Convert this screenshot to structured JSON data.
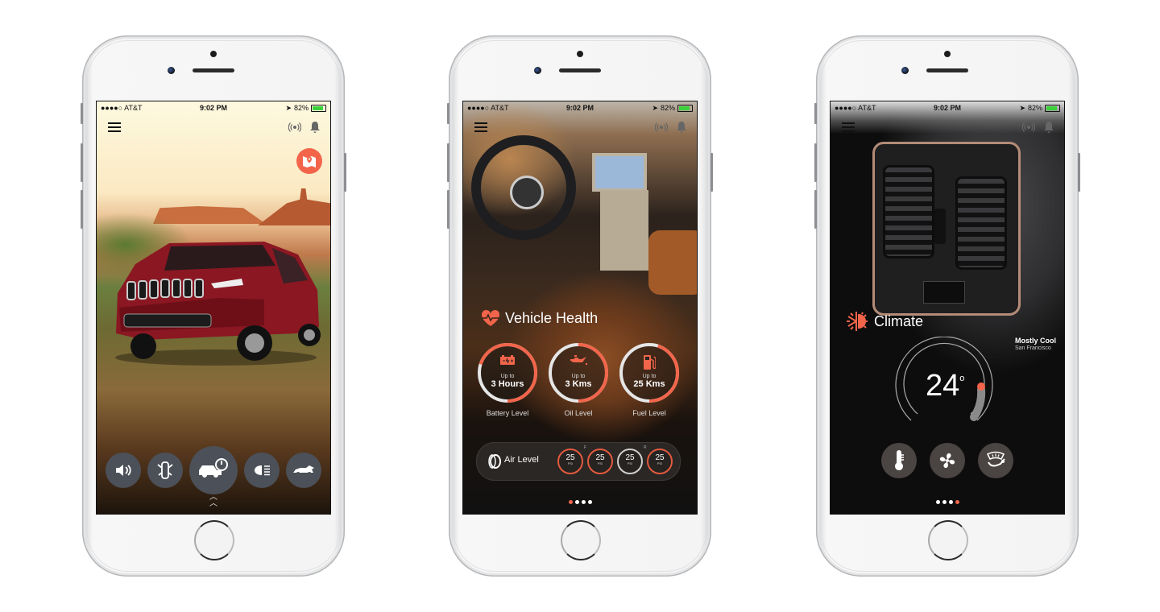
{
  "status_bar": {
    "carrier": "●●●●○ AT&T",
    "time": "9:02 PM",
    "battery": "82%",
    "icons": [
      "wifi-icon",
      "orientation-lock-icon",
      "location-icon",
      "bluetooth-icon",
      "battery-icon",
      "charging-icon"
    ]
  },
  "header": {
    "menu_icon": "hamburger-menu-icon",
    "icons": [
      "signal-broadcast-icon",
      "notification-bell-icon"
    ]
  },
  "phones": [
    {
      "screen": "home",
      "map_button": "map-pin-icon",
      "controls": [
        {
          "name": "horn",
          "icon": "speaker-icon",
          "active": false
        },
        {
          "name": "doors",
          "icon": "car-doors-icon",
          "active": true
        },
        {
          "name": "remote-start",
          "icon": "car-power-icon",
          "active": true
        },
        {
          "name": "lights",
          "icon": "headlight-icon",
          "active": false
        },
        {
          "name": "trunk",
          "icon": "car-trunk-icon",
          "active": false
        }
      ],
      "expand_icon": "double-chevron-up-icon"
    },
    {
      "screen": "vehicle-health",
      "title": "Vehicle Health",
      "gauges": [
        {
          "prefix": "Up to",
          "value": "3 Hours",
          "label": "Battery Level",
          "icon": "battery-icon",
          "level": 0.7
        },
        {
          "prefix": "Up to",
          "value": "3 Kms",
          "label": "Oil Level",
          "icon": "oil-can-icon",
          "level": 0.5
        },
        {
          "prefix": "Up to",
          "value": "25 Kms",
          "label": "Fuel Level",
          "icon": "fuel-pump-icon",
          "level": 0.45
        }
      ],
      "air": {
        "label": "Air Level",
        "tyres": [
          {
            "value": "25",
            "unit": "PSI"
          },
          {
            "value": "25",
            "unit": "PSI"
          },
          {
            "value": "25",
            "unit": "PSI"
          },
          {
            "value": "25",
            "unit": "PSI"
          }
        ],
        "front_marker": "F",
        "rear_marker": "R"
      },
      "page_index": 1,
      "page_count": 4
    },
    {
      "screen": "climate",
      "title": "Climate",
      "weather": "Mostly Cool",
      "location": "San Francisco",
      "temperature": "24",
      "degree": "o",
      "controls": [
        {
          "name": "temperature",
          "icon": "thermometer-icon",
          "active": true
        },
        {
          "name": "fan",
          "icon": "fan-icon",
          "active": false
        },
        {
          "name": "defrost",
          "icon": "windshield-defrost-icon",
          "active": false
        }
      ],
      "page_index": 4,
      "page_count": 4
    }
  ],
  "colors": {
    "accent": "#f2654b",
    "button_dark": "#4c5058"
  }
}
